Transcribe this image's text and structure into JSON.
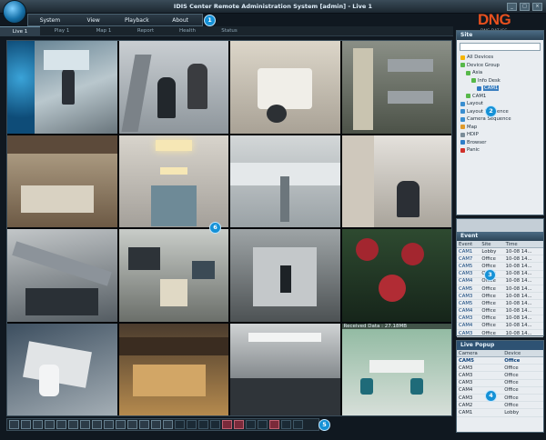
{
  "window": {
    "title": "IDIS Center Remote Administration System [admin] - Live 1"
  },
  "menu": [
    "System",
    "View",
    "Playback",
    "About"
  ],
  "tabs": [
    {
      "label": "Live 1"
    },
    {
      "label": "Play 1"
    },
    {
      "label": "Map 1"
    },
    {
      "label": "Report"
    },
    {
      "label": "Health"
    },
    {
      "label": "Status"
    }
  ],
  "badges": [
    "1",
    "2",
    "3",
    "4",
    "5",
    "6"
  ],
  "logo": {
    "brand": "DNG",
    "sub": "DNG DAT JSC"
  },
  "site_panel": {
    "header": "Site",
    "tree": [
      {
        "label": "All Devices",
        "indent": 0,
        "icon": "#f5b400"
      },
      {
        "label": "Device Group",
        "indent": 0,
        "icon": "#57b84a"
      },
      {
        "label": "Asia",
        "indent": 1,
        "icon": "#57b84a"
      },
      {
        "label": "Info Desk",
        "indent": 2,
        "icon": "#57b84a"
      },
      {
        "label": "CAM1",
        "indent": 3,
        "icon": "#2f78c4",
        "selected": true
      },
      {
        "label": "CAM1",
        "indent": 1,
        "icon": "#57b84a"
      },
      {
        "label": "Layout",
        "indent": 0,
        "icon": "#3a8ed0"
      },
      {
        "label": "Layout Sequence",
        "indent": 0,
        "icon": "#3a8ed0"
      },
      {
        "label": "Camera Sequence",
        "indent": 0,
        "icon": "#3a8ed0"
      },
      {
        "label": "Map",
        "indent": 0,
        "icon": "#e09a2a"
      },
      {
        "label": "HDIP",
        "indent": 0,
        "icon": "#7a8c98"
      },
      {
        "label": "Browser",
        "indent": 0,
        "icon": "#2e7ec8"
      },
      {
        "label": "Panic",
        "indent": 0,
        "icon": "#d0302a"
      }
    ]
  },
  "event_panel": {
    "header": "Event",
    "columns": [
      "Event",
      "Site",
      "Time"
    ],
    "rows": [
      [
        "CAM1",
        "Lobby",
        "10-08 14..."
      ],
      [
        "CAM7",
        "Office",
        "10-08 14..."
      ],
      [
        "CAM5",
        "Office",
        "10-08 14..."
      ],
      [
        "CAM3",
        "Office",
        "10-08 14..."
      ],
      [
        "CAM4",
        "Office",
        "10-08 14..."
      ],
      [
        "CAM5",
        "Office",
        "10-08 14..."
      ],
      [
        "CAM3",
        "Office",
        "10-08 14..."
      ],
      [
        "CAM5",
        "Office",
        "10-08 14..."
      ],
      [
        "CAM4",
        "Office",
        "10-08 14..."
      ],
      [
        "CAM3",
        "Office",
        "10-08 14..."
      ],
      [
        "CAM4",
        "Office",
        "10-08 14..."
      ],
      [
        "CAM3",
        "Office",
        "10-08 14..."
      ]
    ]
  },
  "live_popup": {
    "header": "Live Popup",
    "columns": [
      "Camera",
      "Device"
    ],
    "rows": [
      [
        "CAM5",
        "Office"
      ],
      [
        "CAM3",
        "Office"
      ],
      [
        "CAM3",
        "Office"
      ],
      [
        "CAM3",
        "Office"
      ],
      [
        "CAM4",
        "Office"
      ],
      [
        "CAM3",
        "Office"
      ],
      [
        "CAM2",
        "Office"
      ],
      [
        "CAM1",
        "Lobby"
      ]
    ]
  },
  "video": {
    "received": "Received Data : 27.18MB"
  }
}
